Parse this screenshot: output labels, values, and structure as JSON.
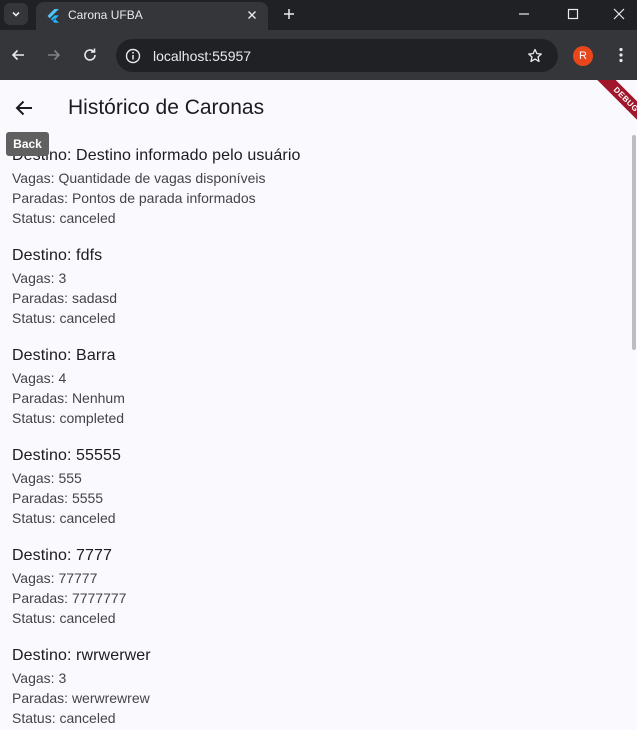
{
  "browser": {
    "tab_title": "Carona UFBA",
    "url": "localhost:55957",
    "profile_initial": "R"
  },
  "app": {
    "title": "Histórico de Caronas",
    "back_tooltip": "Back",
    "debug_banner": "DEBUG",
    "labels": {
      "destination": "Destino: ",
      "seats": "Vagas: ",
      "stops": "Paradas: ",
      "status": "Status: "
    },
    "rides": [
      {
        "destination": "Destino informado pelo usuário",
        "seats": "Quantidade de vagas disponíveis",
        "stops": "Pontos de parada informados",
        "status": "canceled"
      },
      {
        "destination": "fdfs",
        "seats": "3",
        "stops": "sadasd",
        "status": "canceled"
      },
      {
        "destination": "Barra",
        "seats": "4",
        "stops": "Nenhum",
        "status": "completed"
      },
      {
        "destination": "55555",
        "seats": "555",
        "stops": "5555",
        "status": "canceled"
      },
      {
        "destination": "7777",
        "seats": "77777",
        "stops": "7777777",
        "status": "canceled"
      },
      {
        "destination": "rwrwerwer",
        "seats": "3",
        "stops": "werwrewrew",
        "status": "canceled"
      }
    ]
  },
  "colors": {
    "chrome_dark": "#202124",
    "chrome_toolbar": "#35363a",
    "app_background": "#f9f9fe",
    "debug_red": "#a0162b",
    "avatar_orange": "#e8471c"
  }
}
